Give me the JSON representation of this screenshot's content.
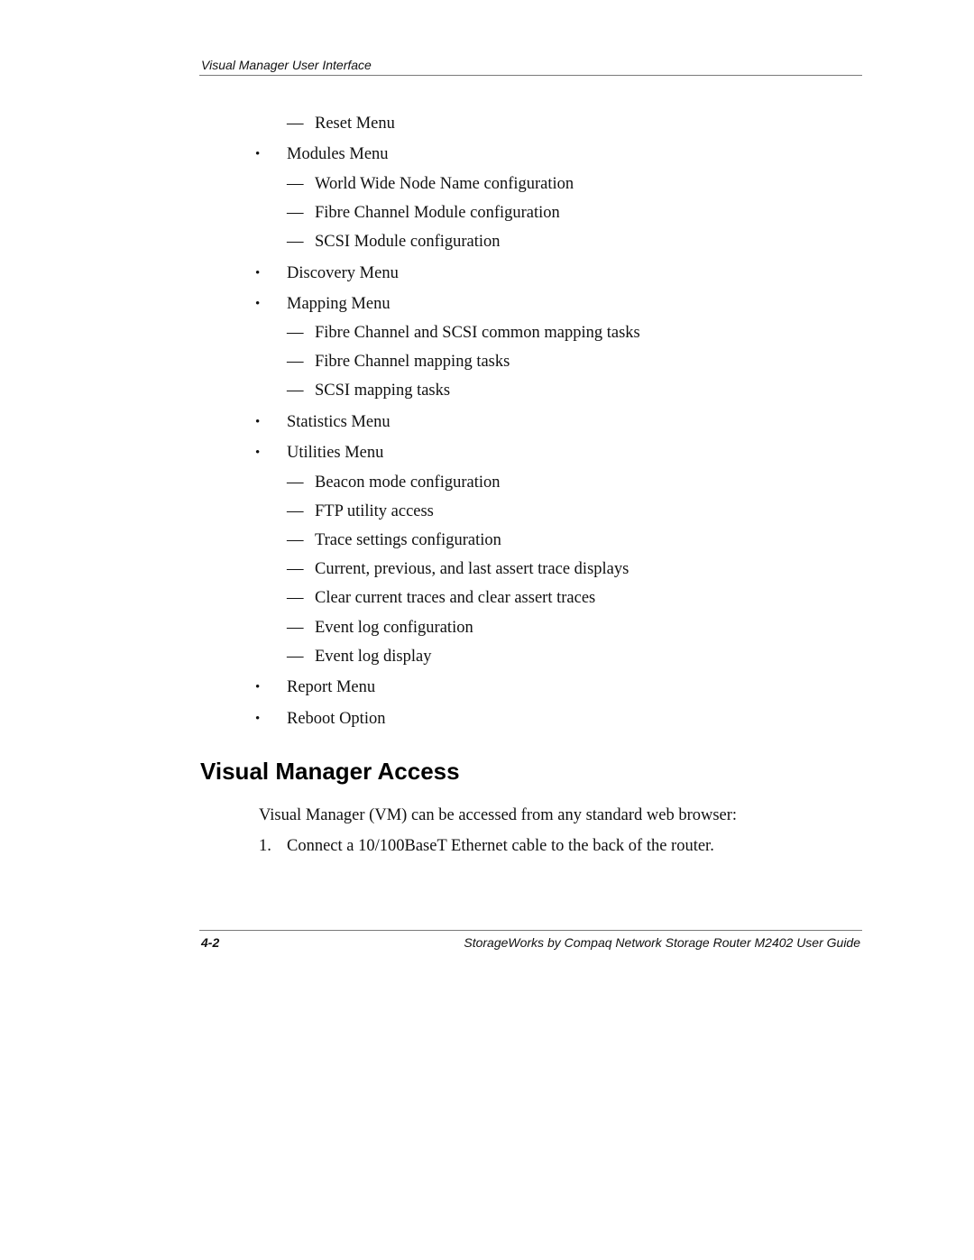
{
  "header": {
    "title": "Visual Manager User Interface"
  },
  "list": [
    {
      "type": "dash",
      "text": "Reset Menu"
    },
    {
      "type": "bullet",
      "text": "Modules Menu"
    },
    {
      "type": "dash",
      "text": "World Wide Node Name configuration"
    },
    {
      "type": "dash",
      "text": "Fibre Channel Module configuration"
    },
    {
      "type": "dash",
      "text": "SCSI Module configuration"
    },
    {
      "type": "bullet",
      "text": "Discovery Menu"
    },
    {
      "type": "bullet",
      "text": "Mapping Menu"
    },
    {
      "type": "dash",
      "text": "Fibre Channel and SCSI common mapping tasks"
    },
    {
      "type": "dash",
      "text": "Fibre Channel mapping tasks"
    },
    {
      "type": "dash",
      "text": "SCSI mapping tasks"
    },
    {
      "type": "bullet",
      "text": "Statistics Menu"
    },
    {
      "type": "bullet",
      "text": "Utilities Menu"
    },
    {
      "type": "dash",
      "text": "Beacon mode configuration"
    },
    {
      "type": "dash",
      "text": "FTP utility access"
    },
    {
      "type": "dash",
      "text": "Trace settings configuration"
    },
    {
      "type": "dash",
      "text": "Current, previous, and last assert trace displays"
    },
    {
      "type": "dash",
      "text": "Clear current traces and clear assert traces"
    },
    {
      "type": "dash",
      "text": "Event log configuration"
    },
    {
      "type": "dash",
      "text": "Event log display"
    },
    {
      "type": "bullet",
      "text": "Report Menu"
    },
    {
      "type": "bullet",
      "text": "Reboot Option"
    }
  ],
  "symbols": {
    "dash": "—",
    "bullet": "•"
  },
  "section": {
    "heading": "Visual Manager Access",
    "intro": "Visual Manager (VM) can be accessed from any standard web browser:",
    "steps": [
      {
        "number": "1.",
        "text": "Connect a 10/100BaseT Ethernet cable to the back of the router."
      }
    ]
  },
  "footer": {
    "page_number": "4-2",
    "title": "StorageWorks by Compaq Network Storage Router M2402 User Guide"
  }
}
